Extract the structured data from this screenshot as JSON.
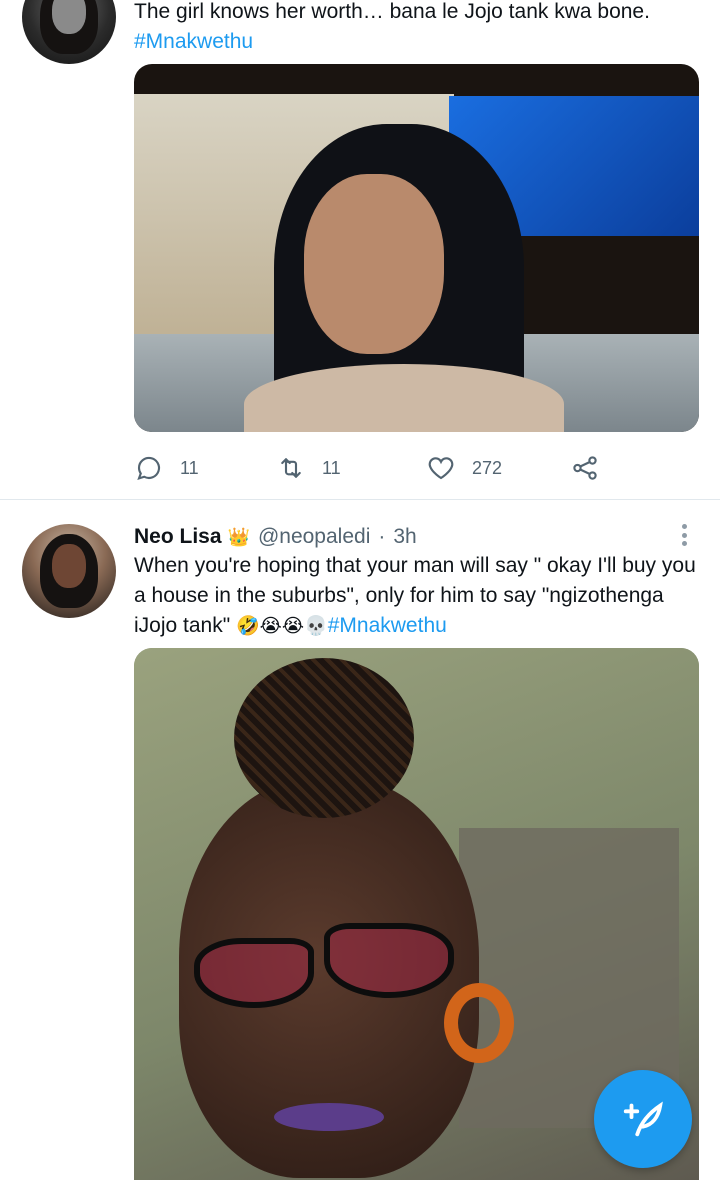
{
  "tweets": [
    {
      "text": "The girl knows her worth… bana le Jojo tank kwa bone.",
      "hashtag": "#Mnakwethu",
      "stats": {
        "replies": "11",
        "retweets": "11",
        "likes": "272"
      }
    },
    {
      "author": "Neo Lisa",
      "author_badge": "👑",
      "handle": "@neopaledi",
      "separator": "·",
      "time": "3h",
      "text": "When you're hoping that your man will say \" okay I'll buy you a house in the suburbs\", only for him to say \"ngizothenga iJojo tank\" ",
      "emojis": "🤣😭😭💀",
      "hashtag": "#Mnakwethu"
    }
  ],
  "icons": {
    "reply": "reply-icon",
    "retweet": "retweet-icon",
    "like": "heart-icon",
    "share": "share-icon",
    "more": "more-options-icon",
    "compose": "compose-tweet-icon"
  },
  "colors": {
    "accent": "#1d9bf0",
    "text": "#0f1419",
    "secondary": "#536471"
  }
}
